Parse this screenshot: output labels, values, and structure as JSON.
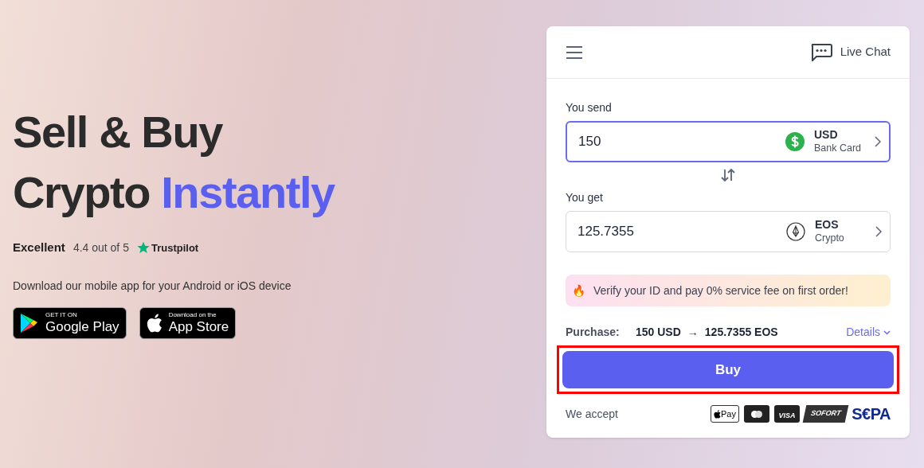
{
  "hero": {
    "headline_line_1": "Sell & Buy",
    "headline_line_2": "Crypto",
    "headline_accent": "Instantly"
  },
  "rating": {
    "label": "Excellent",
    "score": "4.4 out of 5",
    "provider": "Trustpilot"
  },
  "app_prompt": "Download our mobile app for your Android or iOS device",
  "store_badges": [
    {
      "kind": "google",
      "small": "GET IT ON",
      "big": "Google Play"
    },
    {
      "kind": "apple",
      "small": "Download on the",
      "big": "App Store"
    }
  ],
  "widget": {
    "chat_label": "Live Chat",
    "send": {
      "label": "You send",
      "value": "150",
      "focused": true,
      "currency": "USD",
      "method": "Bank Card",
      "kind": "dollar"
    },
    "get": {
      "label": "You get",
      "value": "125.7355",
      "focused": false,
      "currency": "EOS",
      "method": "Crypto",
      "kind": "eos"
    },
    "promo": {
      "emoji": "🔥",
      "text": "Verify your ID and pay 0% service fee on first order!"
    },
    "purchase": {
      "label": "Purchase:",
      "from": "150 USD",
      "arrow": "→",
      "to": "125.7355 EOS",
      "details": "Details"
    },
    "buy_button": {
      "label": "Buy",
      "highlighted": true
    },
    "accept_label": "We accept",
    "payment_methods": [
      {
        "kind": "applepay",
        "label": "Pay"
      },
      {
        "kind": "mastercard"
      },
      {
        "kind": "visa",
        "label": "VISA"
      },
      {
        "kind": "sofort",
        "label": "SOFORT"
      },
      {
        "kind": "sepa",
        "label": "S€PA"
      }
    ]
  }
}
